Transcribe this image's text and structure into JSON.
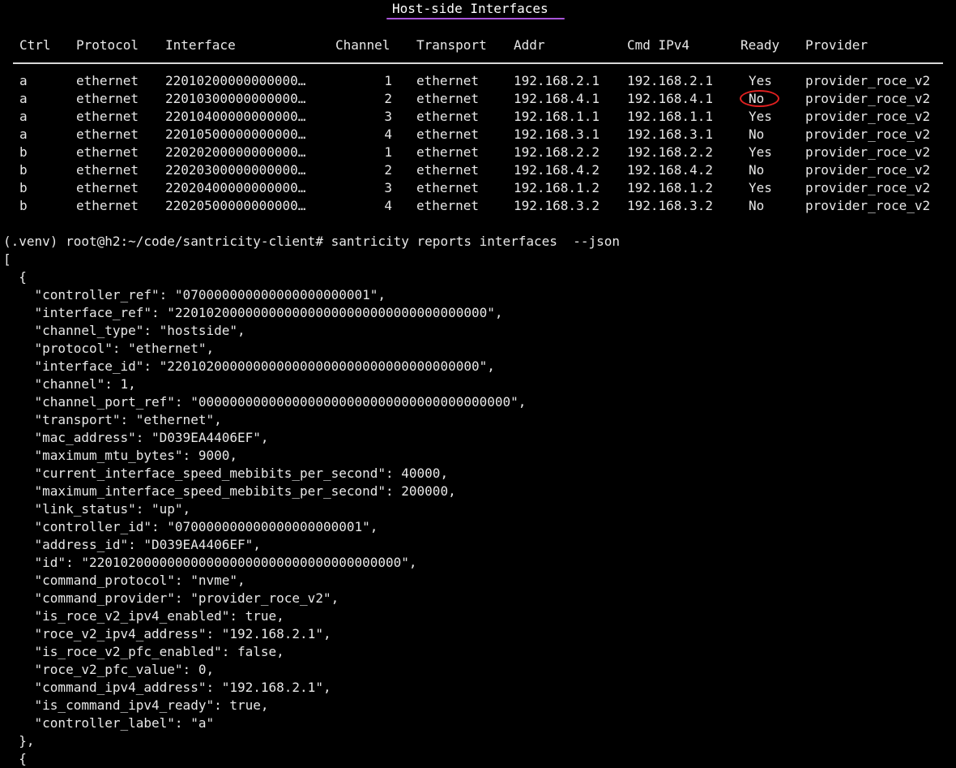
{
  "title": "Host-side Interfaces",
  "table": {
    "columns": [
      "Ctrl",
      "Protocol",
      "Interface",
      "Channel",
      "Transport",
      "Addr",
      "Cmd IPv4",
      "Ready",
      "Provider"
    ],
    "rows": [
      [
        "a",
        "ethernet",
        "22010200000000000…",
        "1",
        "ethernet",
        "192.168.2.1",
        "192.168.2.1",
        "Yes",
        "provider_roce_v2"
      ],
      [
        "a",
        "ethernet",
        "22010300000000000…",
        "2",
        "ethernet",
        "192.168.4.1",
        "192.168.4.1",
        "No",
        "provider_roce_v2"
      ],
      [
        "a",
        "ethernet",
        "22010400000000000…",
        "3",
        "ethernet",
        "192.168.1.1",
        "192.168.1.1",
        "Yes",
        "provider_roce_v2"
      ],
      [
        "a",
        "ethernet",
        "22010500000000000…",
        "4",
        "ethernet",
        "192.168.3.1",
        "192.168.3.1",
        "No",
        "provider_roce_v2"
      ],
      [
        "b",
        "ethernet",
        "22020200000000000…",
        "1",
        "ethernet",
        "192.168.2.2",
        "192.168.2.2",
        "Yes",
        "provider_roce_v2"
      ],
      [
        "b",
        "ethernet",
        "22020300000000000…",
        "2",
        "ethernet",
        "192.168.4.2",
        "192.168.4.2",
        "No",
        "provider_roce_v2"
      ],
      [
        "b",
        "ethernet",
        "22020400000000000…",
        "3",
        "ethernet",
        "192.168.1.2",
        "192.168.1.2",
        "Yes",
        "provider_roce_v2"
      ],
      [
        "b",
        "ethernet",
        "22020500000000000…",
        "4",
        "ethernet",
        "192.168.3.2",
        "192.168.3.2",
        "No",
        "provider_roce_v2"
      ]
    ]
  },
  "terminal": {
    "lines": [
      "(.venv) root@h2:~/code/santricity-client# santricity reports interfaces  --json",
      "[",
      "  {",
      "    \"controller_ref\": \"070000000000000000000001\",",
      "    \"interface_ref\": \"2201020000000000000000000000000000000000\",",
      "    \"channel_type\": \"hostside\",",
      "    \"protocol\": \"ethernet\",",
      "    \"interface_id\": \"2201020000000000000000000000000000000000\",",
      "    \"channel\": 1,",
      "    \"channel_port_ref\": \"0000000000000000000000000000000000000000\",",
      "    \"transport\": \"ethernet\",",
      "    \"mac_address\": \"D039EA4406EF\",",
      "    \"maximum_mtu_bytes\": 9000,",
      "    \"current_interface_speed_mebibits_per_second\": 40000,",
      "    \"maximum_interface_speed_mebibits_per_second\": 200000,",
      "    \"link_status\": \"up\",",
      "    \"controller_id\": \"070000000000000000000001\",",
      "    \"address_id\": \"D039EA4406EF\",",
      "    \"id\": \"2201020000000000000000000000000000000000\",",
      "    \"command_protocol\": \"nvme\",",
      "    \"command_provider\": \"provider_roce_v2\",",
      "    \"is_roce_v2_ipv4_enabled\": true,",
      "    \"roce_v2_ipv4_address\": \"192.168.2.1\",",
      "    \"is_roce_v2_pfc_enabled\": false,",
      "    \"roce_v2_pfc_value\": 0,",
      "    \"command_ipv4_address\": \"192.168.2.1\",",
      "    \"is_command_ipv4_ready\": true,",
      "    \"controller_label\": \"a\"",
      "  },",
      "  {"
    ]
  },
  "colors": {
    "background": "#000000",
    "text": "#e8e8e8",
    "title_underline": "#a855d8",
    "highlight_ring": "#e02020"
  }
}
